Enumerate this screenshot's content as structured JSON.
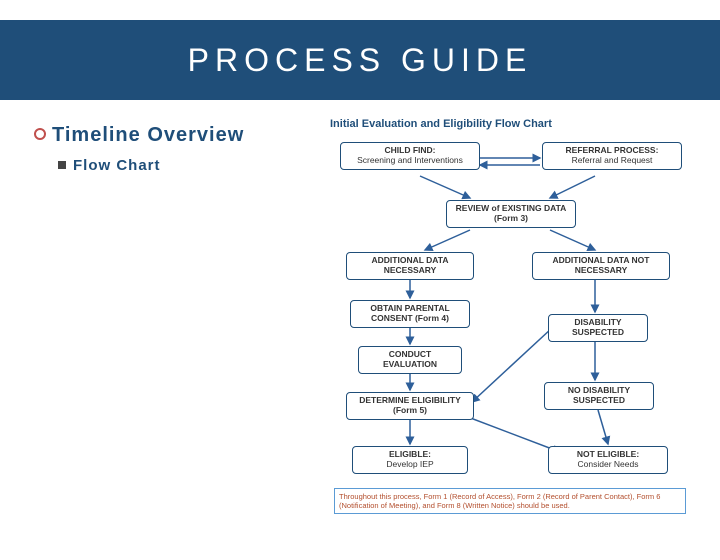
{
  "title": "PROCESS GUIDE",
  "bullets": {
    "main": "Timeline Overview",
    "sub": "Flow Chart"
  },
  "flowchart": {
    "title": "Initial Evaluation and Eligibility Flow Chart",
    "boxes": {
      "childFind": {
        "heading": "CHILD FIND:",
        "sub": "Screening and Interventions"
      },
      "referral": {
        "heading": "REFERRAL PROCESS:",
        "sub": "Referral and Request"
      },
      "review": {
        "heading": "REVIEW of EXISTING DATA (Form 3)",
        "sub": ""
      },
      "addlNeeded": {
        "heading": "ADDITIONAL DATA NECESSARY",
        "sub": ""
      },
      "addlNotNeeded": {
        "heading": "ADDITIONAL DATA NOT NECESSARY",
        "sub": ""
      },
      "consent": {
        "heading": "OBTAIN PARENTAL CONSENT (Form 4)",
        "sub": ""
      },
      "conduct": {
        "heading": "CONDUCT EVALUATION",
        "sub": ""
      },
      "disSusp": {
        "heading": "DISABILITY SUSPECTED",
        "sub": ""
      },
      "determine": {
        "heading": "DETERMINE ELIGIBILITY (Form 5)",
        "sub": ""
      },
      "noDisSusp": {
        "heading": "NO DISABILITY SUSPECTED",
        "sub": ""
      },
      "eligible": {
        "heading": "ELIGIBLE:",
        "sub": "Develop IEP"
      },
      "notEligible": {
        "heading": "NOT ELIGIBLE:",
        "sub": "Consider Needs"
      }
    },
    "note": "Throughout this process, Form 1 (Record of Access), Form 2 (Record of Parent Contact), Form 6 (Notification of Meeting), and Form 8 (Written Notice) should be used."
  }
}
